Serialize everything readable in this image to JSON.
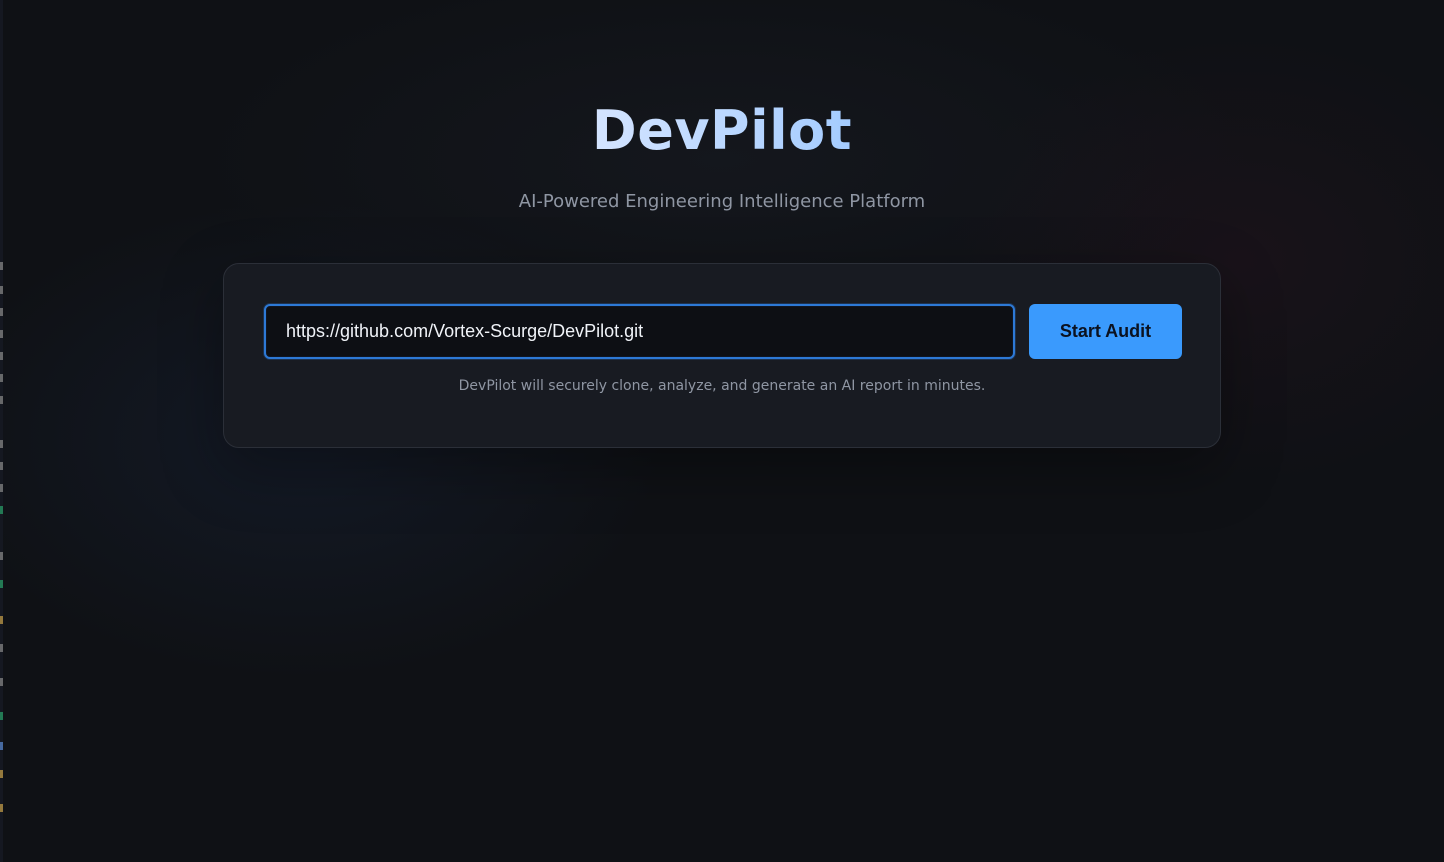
{
  "header": {
    "title": "DevPilot",
    "subtitle": "AI-Powered Engineering Intelligence Platform"
  },
  "audit_form": {
    "repo_url_value": "https://github.com/Vortex-Scurge/DevPilot.git",
    "start_button_label": "Start Audit",
    "hint_text": "DevPilot will securely clone, analyze, and generate an AI report in minutes."
  },
  "colors": {
    "background": "#0f1115",
    "card_background": "#181b22",
    "accent": "#3a9afd",
    "input_border": "#2d79d6",
    "muted_text": "#8f96a3"
  }
}
